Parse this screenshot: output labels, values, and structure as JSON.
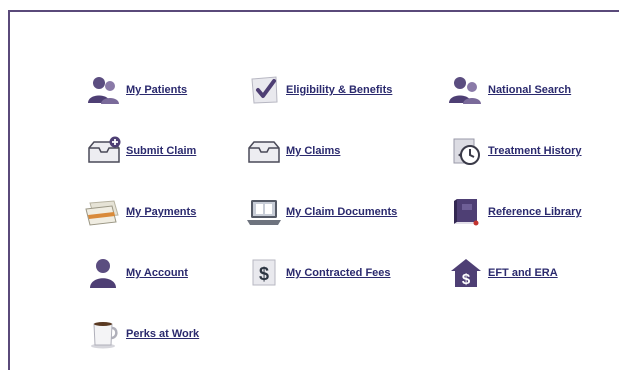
{
  "tiles": [
    {
      "label": "My Patients",
      "icon": "patients-icon"
    },
    {
      "label": "Eligibility & Benefits",
      "icon": "checkmark-icon"
    },
    {
      "label": "National Search",
      "icon": "people-search-icon"
    },
    {
      "label": "Submit Claim",
      "icon": "inbox-plus-icon"
    },
    {
      "label": "My Claims",
      "icon": "inbox-icon"
    },
    {
      "label": "Treatment History",
      "icon": "history-icon"
    },
    {
      "label": "My Payments",
      "icon": "money-envelope-icon"
    },
    {
      "label": "My Claim Documents",
      "icon": "laptop-icon"
    },
    {
      "label": "Reference Library",
      "icon": "book-icon"
    },
    {
      "label": "My Account",
      "icon": "user-icon"
    },
    {
      "label": "My Contracted Fees",
      "icon": "dollar-icon"
    },
    {
      "label": "EFT and ERA",
      "icon": "house-dollar-icon"
    },
    {
      "label": "Perks at Work",
      "icon": "coffee-mug-icon"
    }
  ],
  "colors": {
    "link": "#2b2a6e",
    "frame": "#5a4a7a",
    "icon_purple": "#4e3f74"
  }
}
